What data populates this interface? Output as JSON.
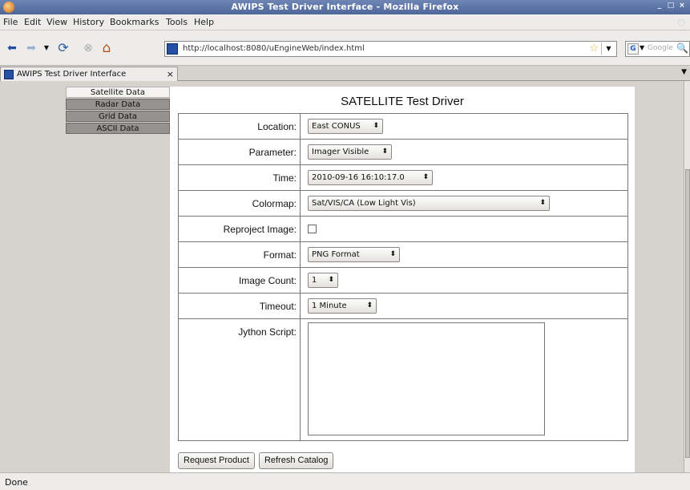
{
  "window": {
    "title": "AWIPS Test Driver Interface - Mozilla Firefox"
  },
  "menu": [
    {
      "label": "File"
    },
    {
      "label": "Edit"
    },
    {
      "label": "View"
    },
    {
      "label": "History"
    },
    {
      "label": "Bookmarks"
    },
    {
      "label": "Tools"
    },
    {
      "label": "Help"
    }
  ],
  "nav": {
    "url": "http://localhost:8080/uEngineWeb/index.html",
    "search_placeholder": "Google"
  },
  "tab": {
    "label": "AWIPS Test Driver Interface",
    "close": "×"
  },
  "sidenav": {
    "items": [
      {
        "label": "Satellite Data"
      },
      {
        "label": "Radar Data"
      },
      {
        "label": "Grid Data"
      },
      {
        "label": "ASCII Data"
      }
    ]
  },
  "panel": {
    "heading": "SATELLITE Test Driver"
  },
  "form": {
    "location": {
      "label": "Location:",
      "value": "East CONUS"
    },
    "parameter": {
      "label": "Parameter:",
      "value": "Imager Visible"
    },
    "time": {
      "label": "Time:",
      "value": "2010-09-16 16:10:17.0"
    },
    "colormap": {
      "label": "Colormap:",
      "value": "Sat/VIS/CA (Low Light Vis)"
    },
    "reproject": {
      "label": "Reproject Image:",
      "checked": false
    },
    "format": {
      "label": "Format:",
      "value": "PNG Format"
    },
    "image_count": {
      "label": "Image Count:",
      "value": "1"
    },
    "timeout": {
      "label": "Timeout:",
      "value": "1 Minute"
    },
    "jython": {
      "label": "Jython Script:",
      "value": ""
    }
  },
  "buttons": {
    "request": "Request Product",
    "refresh": "Refresh Catalog"
  },
  "status": {
    "text": "Done"
  },
  "icons": {
    "arrow": "⬍",
    "back": "⬅",
    "forward": "➡",
    "reload": "⟳",
    "stop": "⊗",
    "home": "⌂",
    "star": "☆",
    "dropdown": "▼",
    "magnifier": "🔍"
  },
  "colors": {
    "titlebar": "#4d6699",
    "nav_inactive": "#959290",
    "panel_bg": "#ffffff"
  }
}
